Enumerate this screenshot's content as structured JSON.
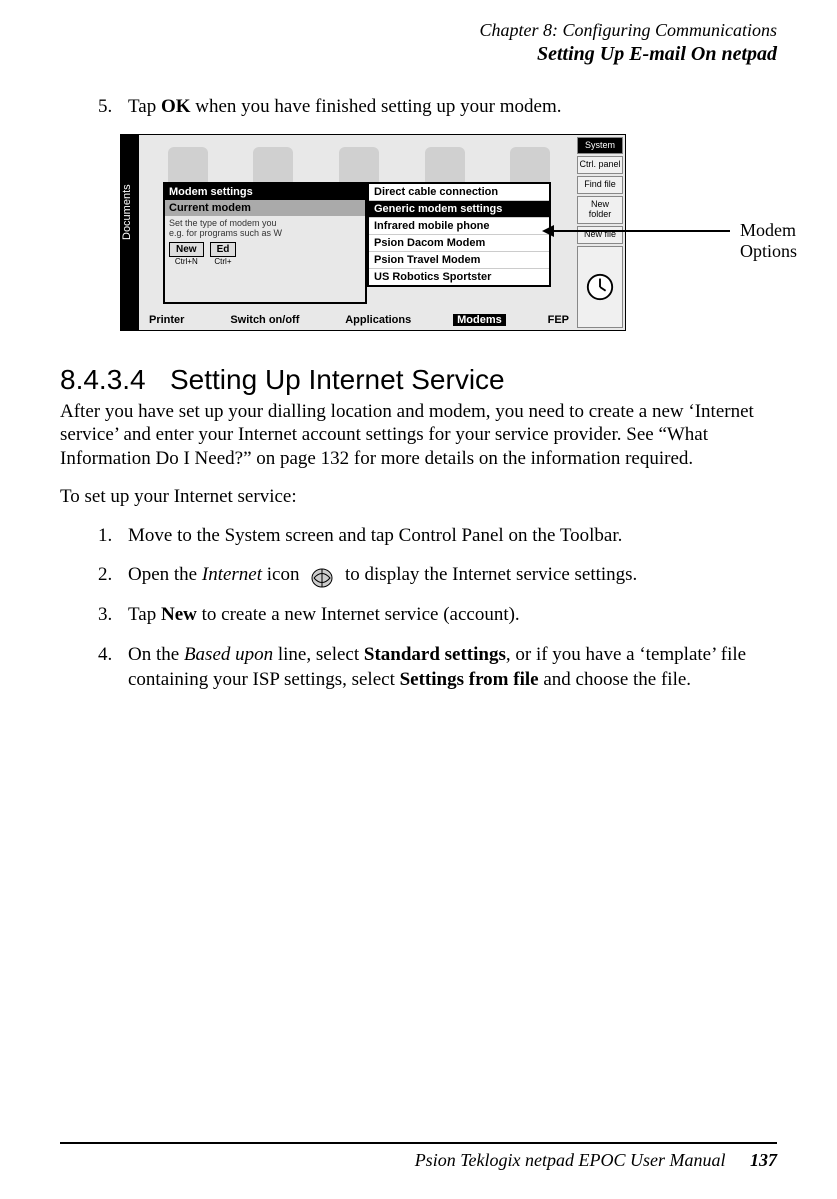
{
  "header": {
    "line1": "Chapter 8:  Configuring Communications",
    "line2": "Setting Up E-mail On netpad"
  },
  "step5": {
    "num": "5.",
    "pre": "Tap ",
    "bold": "OK",
    "post": " when you have finished setting up your modem."
  },
  "screenshot": {
    "doc_tab": "Documents",
    "bottom": {
      "printer": "Printer",
      "switch": "Switch on/off",
      "apps": "Applications",
      "modems": "Modems",
      "fep": "FEP"
    },
    "rightcol": {
      "system": "System",
      "ctrl": "Ctrl. panel",
      "find": "Find file",
      "newfolder": "New folder",
      "newfile": "New file"
    },
    "dialog": {
      "title": "Modem settings",
      "row_label": "Current modem",
      "hint": "Set the type of modem you\ne.g. for programs such as W",
      "new_btn": "New",
      "ed_btn": "Ed",
      "new_sc": "Ctrl+N",
      "ed_sc": "Ctrl+"
    },
    "dropdown": [
      "Direct cable connection",
      "Generic modem settings",
      "Infrared mobile phone",
      "Psion Dacom Modem",
      "Psion Travel Modem",
      "US Robotics Sportster"
    ],
    "arrow_label": "Modem Options"
  },
  "section": {
    "num": "8.4.3.4",
    "title": "Setting Up Internet Service"
  },
  "para1": "After you have set up your dialling location and modem, you need to create a new ‘Internet service’ and enter your Internet account settings for your service provider. See “What Information Do I Need?” on page 132 for more details on the information required.",
  "lead": "To set up your Internet service:",
  "steps": {
    "s1": {
      "n": "1.",
      "t": "Move to the System screen and tap Control Panel on the Toolbar."
    },
    "s2": {
      "n": "2.",
      "pre": "Open the ",
      "it": "Internet",
      "mid": " icon",
      "post": " to display the Internet service settings."
    },
    "s3": {
      "n": "3.",
      "pre": "Tap ",
      "b": "New",
      "post": " to create a new Internet service (account)."
    },
    "s4": {
      "n": "4.",
      "pre": "On the ",
      "it": "Based upon",
      "mid": " line, select ",
      "b1": "Standard settings",
      "mid2": ", or if you have a ‘template’ file containing your ISP settings, select ",
      "b2": "Settings from file",
      "post": " and choose the file."
    }
  },
  "footer": {
    "text": "Psion Teklogix netpad EPOC User Manual",
    "page": "137"
  }
}
